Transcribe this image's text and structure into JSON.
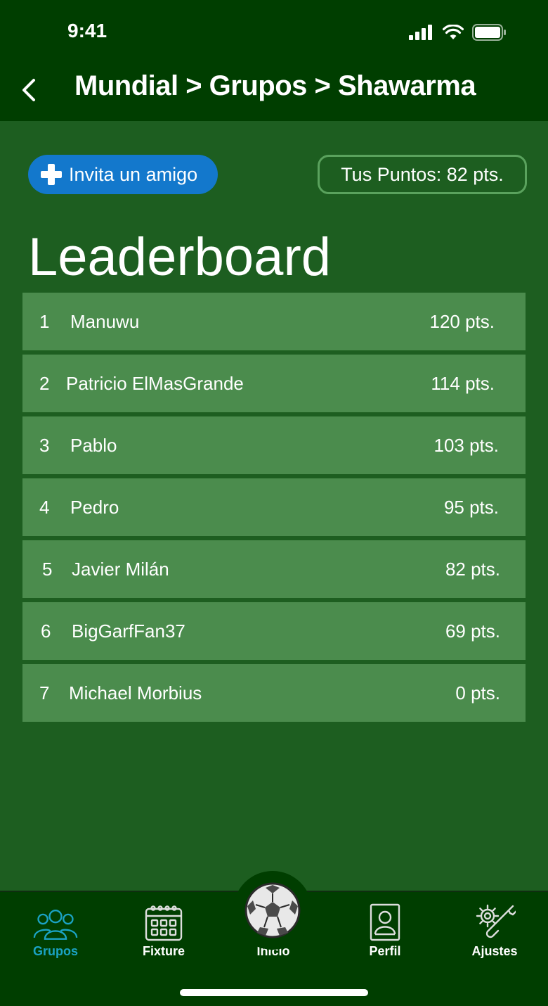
{
  "status": {
    "time": "9:41"
  },
  "header": {
    "title": "Mundial > Grupos > Shawarma"
  },
  "actions": {
    "invite_label": "Invita un amigo",
    "points_label": "Tus Puntos: 82 pts."
  },
  "leaderboard": {
    "title": "Leaderboard",
    "rows": [
      {
        "rank": "1",
        "name": "Manuwu",
        "points": "120 pts."
      },
      {
        "rank": "2",
        "name": "Patricio ElMasGrande",
        "points": "114 pts."
      },
      {
        "rank": "3",
        "name": "Pablo",
        "points": "103 pts."
      },
      {
        "rank": "4",
        "name": "Pedro",
        "points": "95 pts."
      },
      {
        "rank": "5",
        "name": "Javier Milán",
        "points": "82 pts."
      },
      {
        "rank": "6",
        "name": "BigGarfFan37",
        "points": "69 pts."
      },
      {
        "rank": "7",
        "name": "Michael Morbius",
        "points": "0 pts."
      }
    ]
  },
  "tabs": [
    {
      "label": "Grupos",
      "icon": "group-icon",
      "active": true
    },
    {
      "label": "Fixture",
      "icon": "calendar-icon",
      "active": false
    },
    {
      "label": "Inicio",
      "icon": "soccer-ball-icon",
      "active": false
    },
    {
      "label": "Perfil",
      "icon": "profile-icon",
      "active": false
    },
    {
      "label": "Ajustes",
      "icon": "settings-icon",
      "active": false
    }
  ],
  "colors": {
    "background": "#1d5e20",
    "header": "#003e00",
    "row": "#4b8c4d",
    "invite_button": "#1378cc",
    "active_tab": "#1ba3c4"
  }
}
